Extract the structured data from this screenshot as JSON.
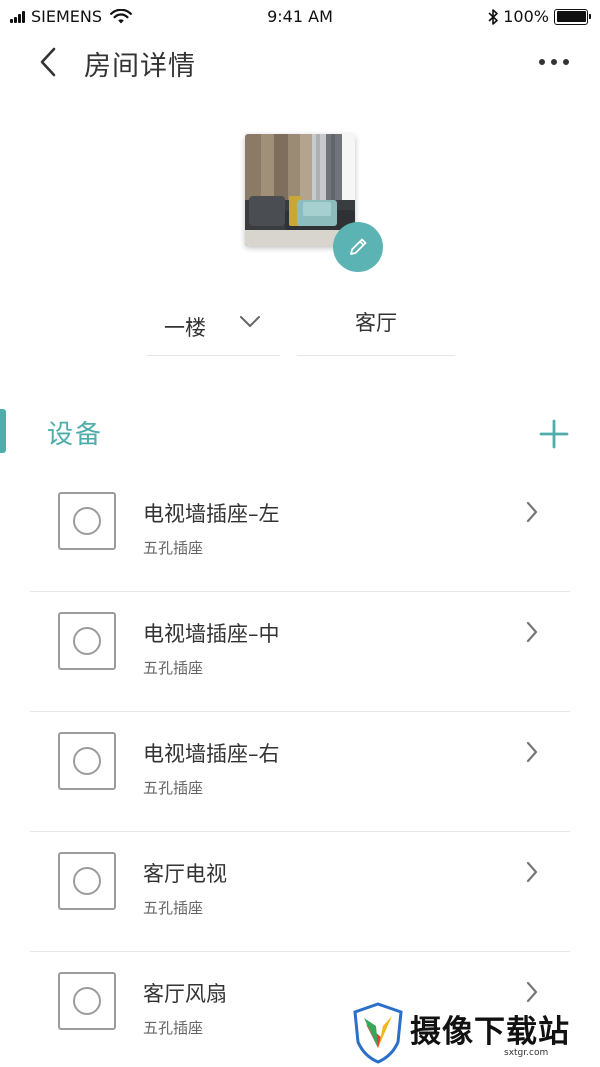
{
  "status_bar": {
    "carrier": "SIEMENS",
    "time": "9:41 AM",
    "battery": "100%",
    "battery_level": 1.0
  },
  "nav": {
    "title": "房间详情",
    "back_icon": "chevron-left-icon",
    "more_icon": "more-horizontal-icon"
  },
  "room": {
    "floor": "一楼",
    "name": "客厅",
    "edit_icon": "pencil-icon"
  },
  "section": {
    "title": "设备",
    "add_icon": "plus-icon"
  },
  "devices": [
    {
      "name": "电视墙插座–左",
      "type": "五孔插座"
    },
    {
      "name": "电视墙插座–中",
      "type": "五孔插座"
    },
    {
      "name": "电视墙插座–右",
      "type": "五孔插座"
    },
    {
      "name": "客厅电视",
      "type": "五孔插座"
    },
    {
      "name": "客厅风扇",
      "type": "五孔插座"
    }
  ],
  "watermark": {
    "text": "摄像下载站",
    "url": "sxtgr.com"
  },
  "colors": {
    "accent": "#4fadaa",
    "edit_button": "#5bb3b3",
    "divider": "#e8e8e8",
    "icon_gray": "#9c9c9c"
  }
}
